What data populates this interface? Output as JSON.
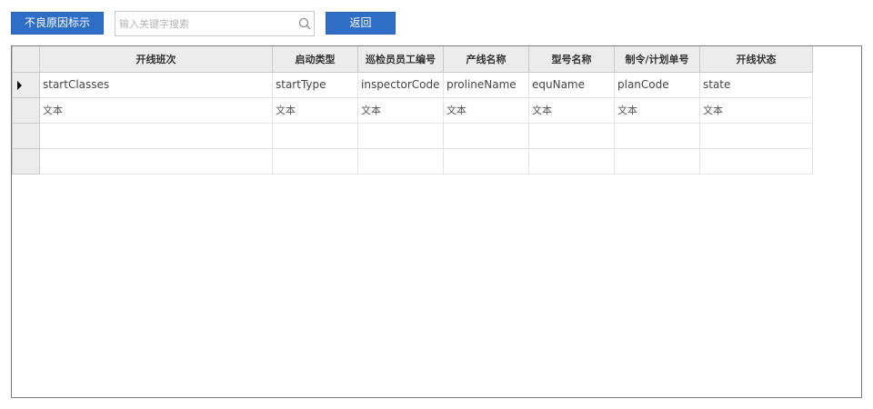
{
  "toolbar": {
    "defect_button_label": "不良原因标示",
    "search_placeholder": "输入关键字搜索",
    "search_value": "",
    "back_button_label": "返回"
  },
  "grid": {
    "columns": [
      "开线班次",
      "启动类型",
      "巡检员员工编号",
      "产线名称",
      "型号名称",
      "制令/计划单号",
      "开线状态"
    ],
    "binding_row": [
      "startClasses",
      "startType",
      "inspectorCode",
      "prolineName",
      "equName",
      "planCode",
      "state"
    ],
    "template_row": [
      "文本",
      "文本",
      "文本",
      "文本",
      "文本",
      "文本",
      "文本"
    ]
  }
}
